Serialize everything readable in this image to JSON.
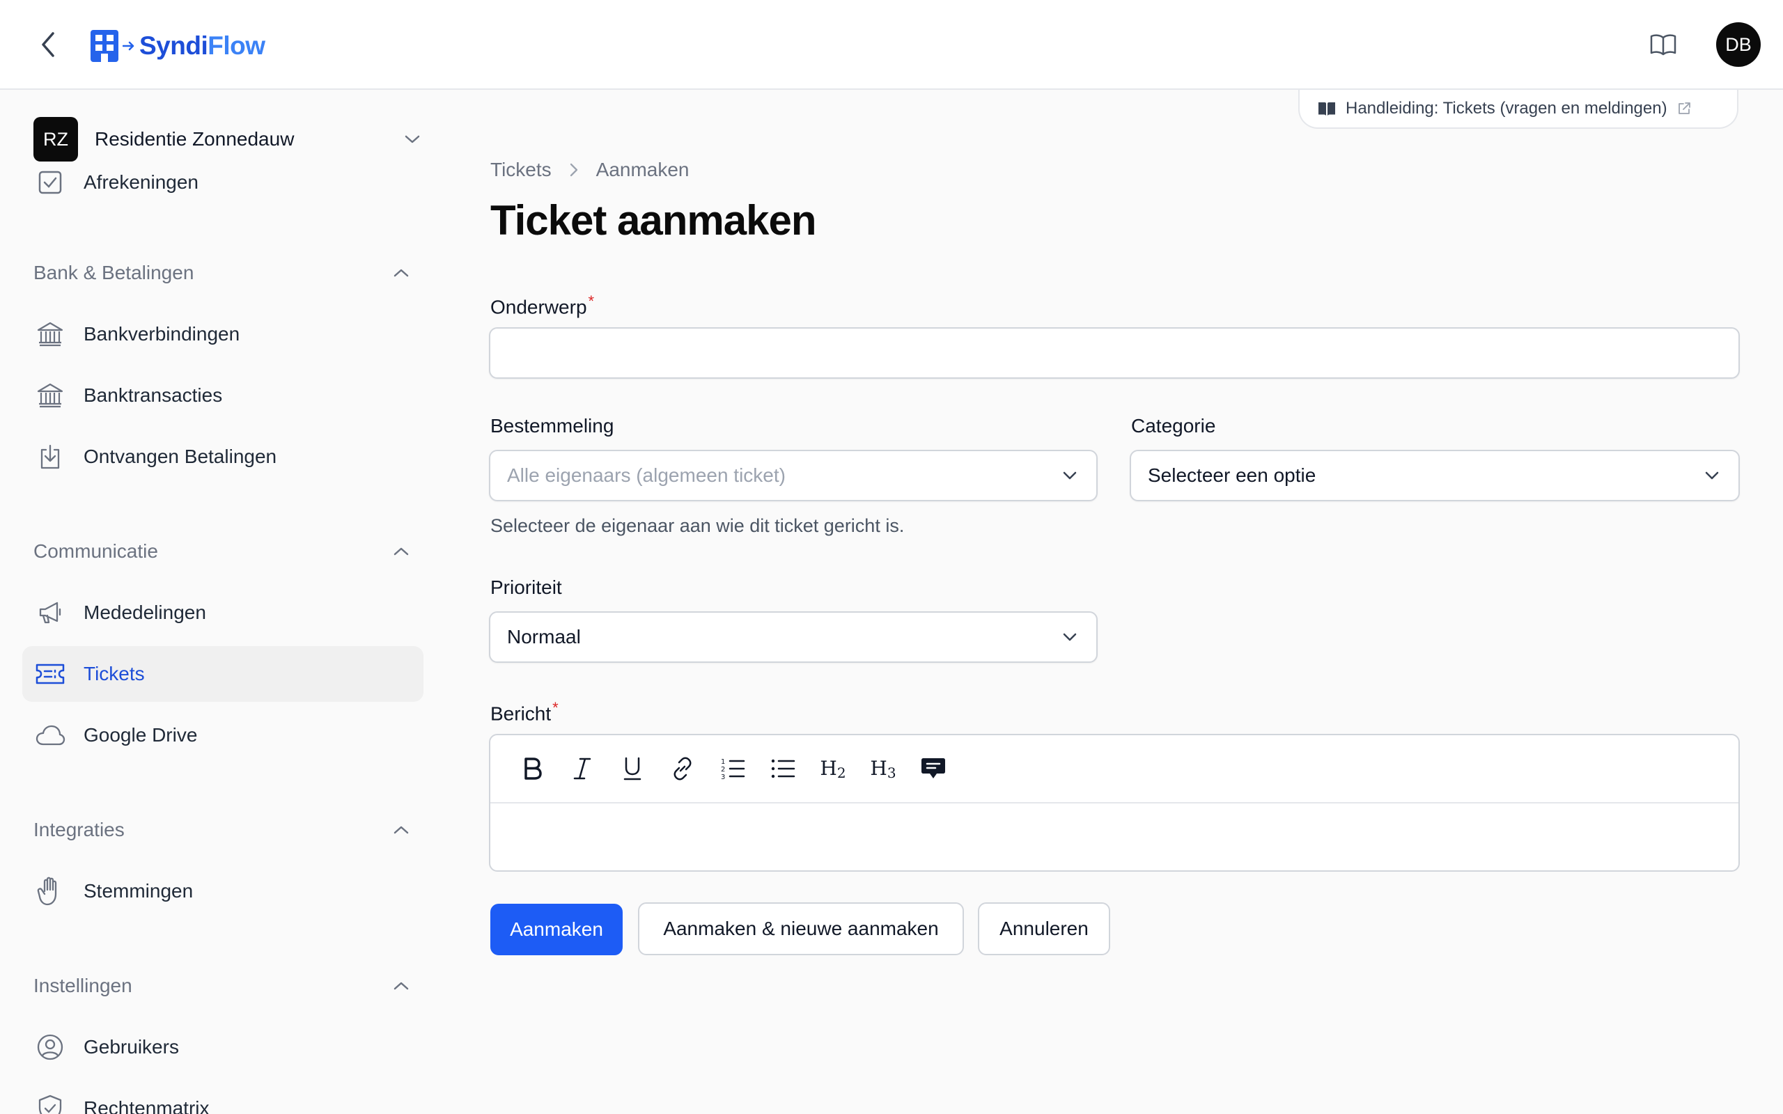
{
  "app": {
    "name_part1": "Syndi",
    "name_part2": "Flow"
  },
  "user": {
    "initials": "DB"
  },
  "tenant": {
    "initials": "RZ",
    "name": "Residentie Zonnedauw"
  },
  "sidebar": {
    "partial_item": "Afrekeningen",
    "groups": [
      {
        "label": "Bank & Betalingen",
        "items": [
          "Bankverbindingen",
          "Banktransacties",
          "Ontvangen Betalingen"
        ]
      },
      {
        "label": "Communicatie",
        "items": [
          "Mededelingen",
          "Tickets",
          "Google Drive"
        ]
      },
      {
        "label": "Integraties",
        "items": [
          "Stemmingen"
        ]
      },
      {
        "label": "Instellingen",
        "items": [
          "Gebruikers",
          "Rechtenmatrix"
        ]
      }
    ],
    "active_item": "Tickets"
  },
  "guide": {
    "label": "Handleiding: Tickets (vragen en meldingen)"
  },
  "breadcrumb": {
    "parent": "Tickets",
    "current": "Aanmaken"
  },
  "page": {
    "title": "Ticket aanmaken"
  },
  "form": {
    "subject": {
      "label": "Onderwerp",
      "required": "*",
      "value": ""
    },
    "recipient": {
      "label": "Bestemmeling",
      "placeholder": "Alle eigenaars (algemeen ticket)",
      "helper": "Selecteer de eigenaar aan wie dit ticket gericht is."
    },
    "category": {
      "label": "Categorie",
      "value": "Selecteer een optie"
    },
    "priority": {
      "label": "Prioriteit",
      "value": "Normaal"
    },
    "message": {
      "label": "Bericht",
      "required": "*"
    }
  },
  "toolbar": {
    "h2": "H",
    "h2_sub": "2",
    "h3": "H",
    "h3_sub": "3"
  },
  "actions": {
    "create": "Aanmaken",
    "create_another": "Aanmaken & nieuwe aanmaken",
    "cancel": "Annuleren"
  },
  "colors": {
    "accent": "#1d5cf5",
    "active_text": "#1d4ed8",
    "required": "#dc2626"
  }
}
